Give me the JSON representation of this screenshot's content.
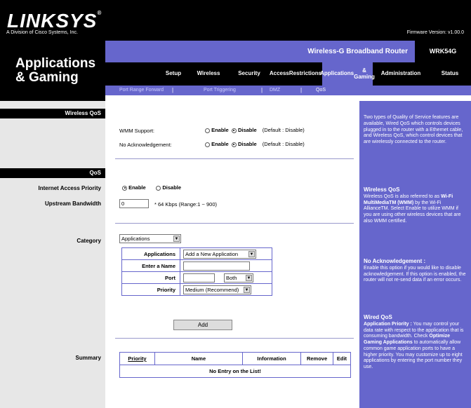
{
  "brand": {
    "logo": "LINKSYS",
    "registered": "®",
    "subtitle": "A Division of Cisco Systems, Inc.",
    "firmware": "Firmware Version: v1.00.0"
  },
  "page": {
    "title_line1": "Applications",
    "title_line2": "& Gaming"
  },
  "product": {
    "name": "Wireless-G Broadband Router",
    "model": "WRK54G"
  },
  "tabs": [
    {
      "label": "Setup"
    },
    {
      "label": "Wireless"
    },
    {
      "label": "Security"
    },
    {
      "label_line1": "Access",
      "label_line2": "Restrictions"
    },
    {
      "label_line1": "Applications",
      "label_line2": "& Gaming"
    },
    {
      "label": "Administration"
    },
    {
      "label": "Status"
    }
  ],
  "subtabs": [
    "Port Range Forward",
    "Port Triggering",
    "DMZ",
    "QoS"
  ],
  "separator": "|",
  "wireless_qos": {
    "section": "Wireless QoS",
    "wmm_label": "WMM Support:",
    "noack_label": "No Acknowledgement:",
    "enable": "Enable",
    "disable": "Disable",
    "default_hint": "(Default : Disable)"
  },
  "qos": {
    "section": "QoS",
    "iap_label": "Internet Access Priority",
    "enable": "Enable",
    "disable": "Disable",
    "upstream_label": "Upstream Bandwidth",
    "upstream_value": "0",
    "upstream_hint": "* 64 Kbps (Range:1 ~ 900)",
    "category_label": "Category",
    "category_value": "Applications",
    "apps_label": "Applications",
    "apps_value": "Add a New Application",
    "name_label": "Enter a Name",
    "port_label": "Port",
    "port_proto": "Both",
    "priority_label": "Priority",
    "priority_value": "Medium (Recommend)",
    "add_button": "Add"
  },
  "summary": {
    "label": "Summary",
    "columns": [
      "Priority",
      "Name",
      "Information",
      "Remove",
      "Edit"
    ],
    "empty": "No Entry on the List!"
  },
  "help": {
    "intro": "Two types of Quality of Service features are available, Wired QoS which controls devices plugged in to the router with a Ethernet cable, and Wireless QoS, which control devices that are wirelessly connected to the router.",
    "wqos_title": "Wireless QoS",
    "wqos_text1": "Wireless QoS is also referred to as",
    "wqos_bold": "Wi-Fi MultiMediaTM (WMM)",
    "wqos_text2": "by the Wi-Fi AllianceTM. Select Enable to utilize WMM if you are using other wireless devices that are also WMM certified.",
    "noack_title": "No Acknowledgement :",
    "noack_text": "Enable this option if you would like to disable acknowledgement. If this option is enabled, the router will not re-send data if an error occurs.",
    "wired_title": "Wired QoS",
    "wired_sub": "Application Priority :",
    "wired_text1": "You may control your data rate with respect to the application that is consuming bandwidth. Check",
    "wired_bold": "Optimize Gaming Applications",
    "wired_text2": "to automatically allow common game application ports to have a higher priority. You may customize up to eight applications by entering the port number they use."
  }
}
